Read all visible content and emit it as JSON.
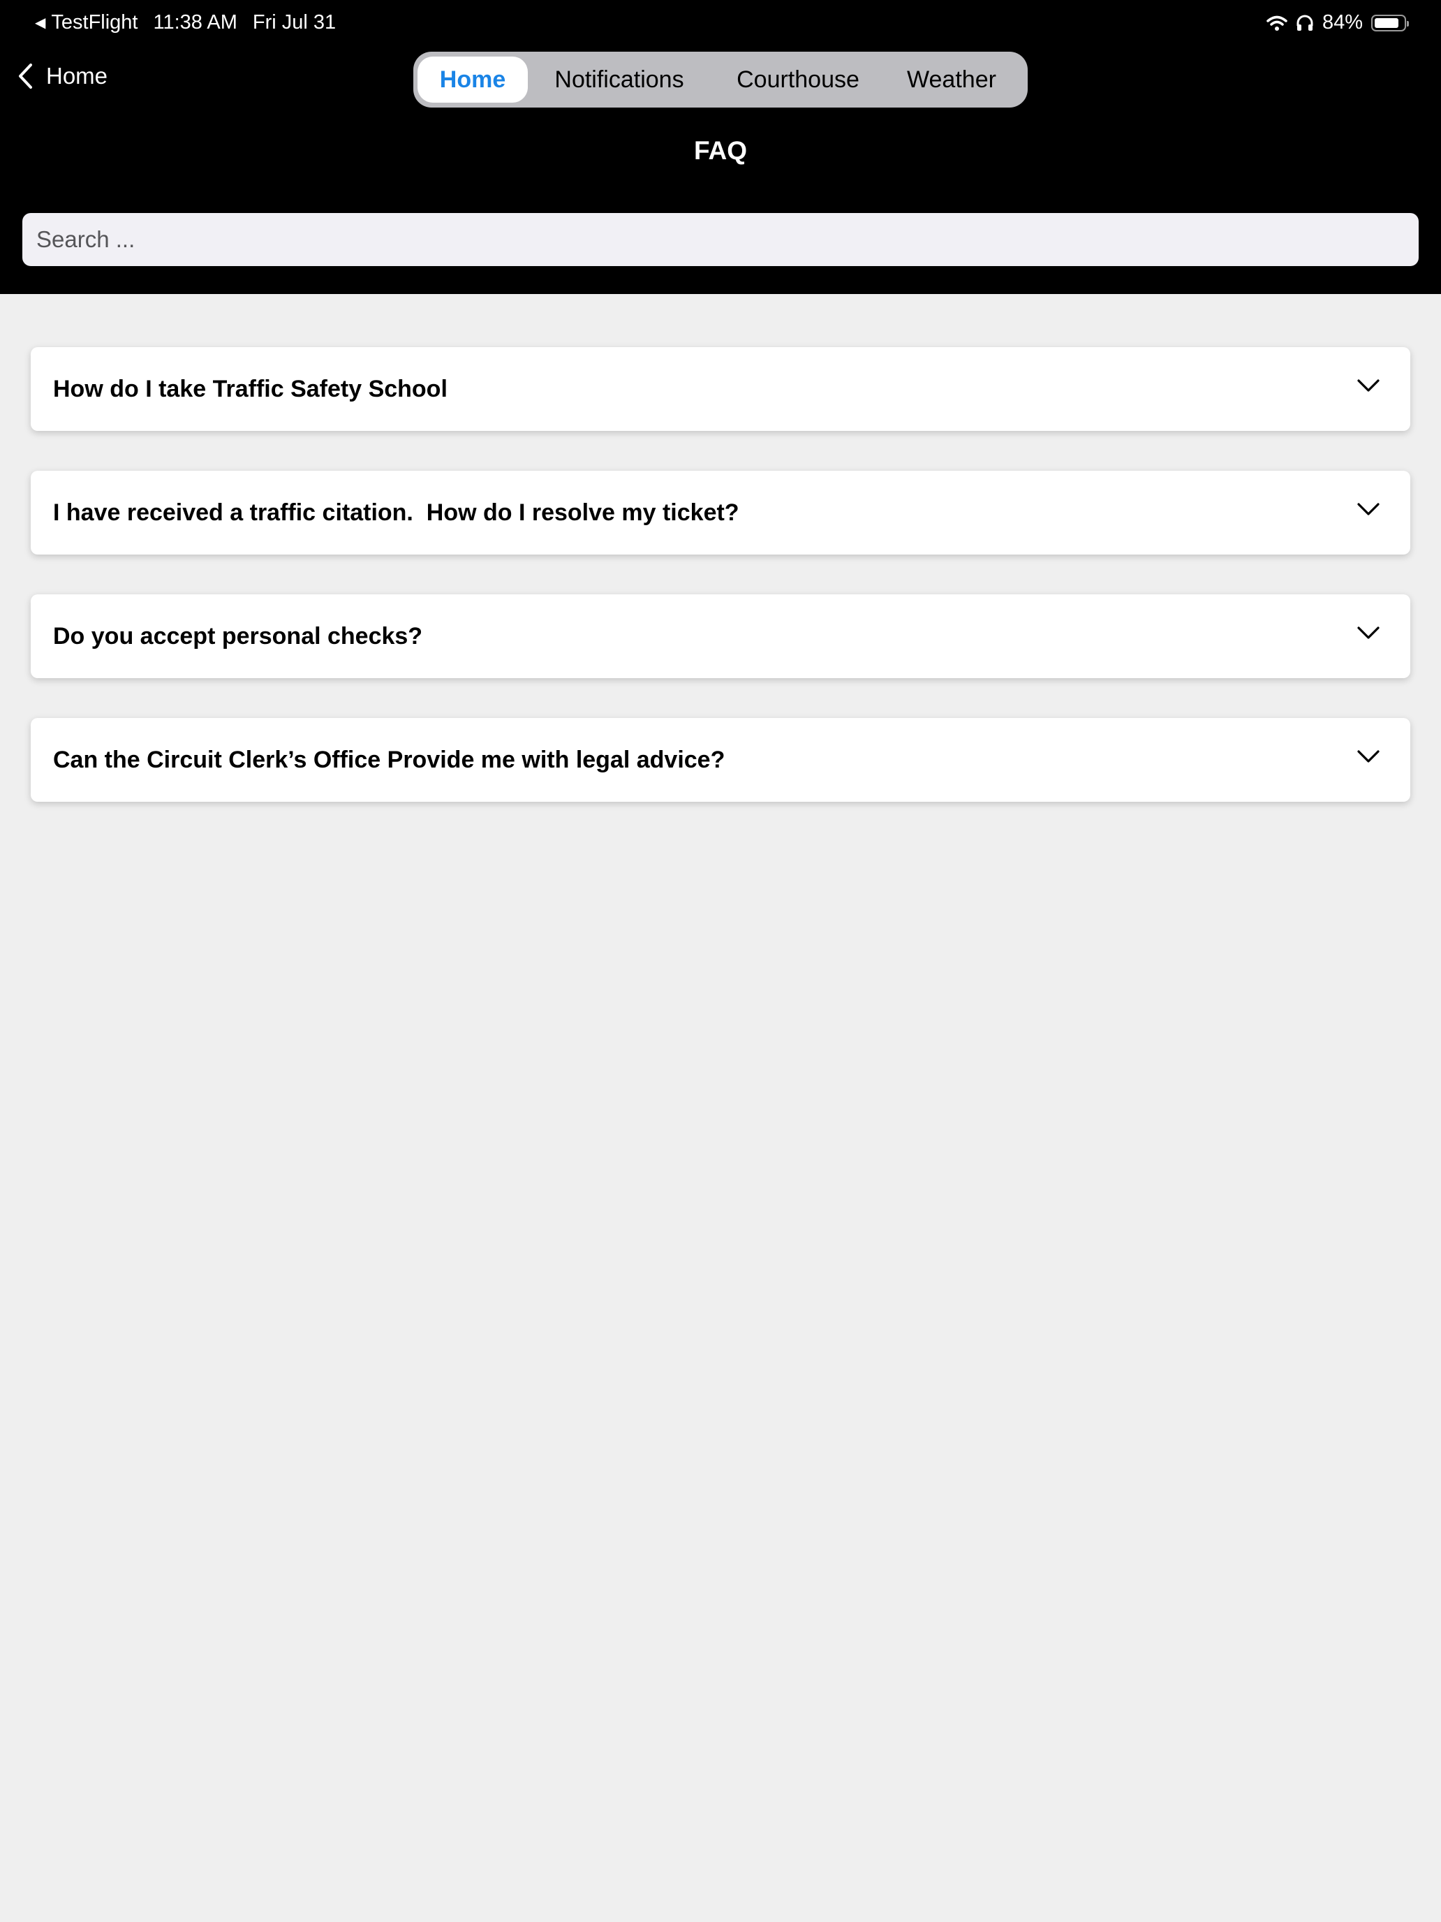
{
  "status_bar": {
    "back_app": "TestFlight",
    "time": "11:38 AM",
    "date": "Fri Jul 31",
    "battery": "84%",
    "battery_level": 0.84,
    "icons": [
      "wifi-icon",
      "headphones-icon",
      "battery-icon"
    ]
  },
  "nav": {
    "back_label": "Home",
    "segments": [
      {
        "label": "Home",
        "active": true
      },
      {
        "label": "Notifications",
        "active": false
      },
      {
        "label": "Courthouse",
        "active": false
      },
      {
        "label": "Weather",
        "active": false
      }
    ],
    "title": "FAQ"
  },
  "search": {
    "placeholder": "Search ...",
    "value": ""
  },
  "faq": {
    "items": [
      {
        "question": "How do I take Traffic Safety School"
      },
      {
        "question": "I have received a traffic citation.  How do I resolve my ticket?"
      },
      {
        "question": "Do you accept personal checks?"
      },
      {
        "question": "Can the Circuit Clerk’s Office Provide me with legal advice?"
      }
    ]
  },
  "colors": {
    "header_bg": "#000000",
    "page_bg": "#efefef",
    "accent": "#1a84e6",
    "segment_bg": "#bdbdc1",
    "search_bg": "#f1f0f5"
  }
}
